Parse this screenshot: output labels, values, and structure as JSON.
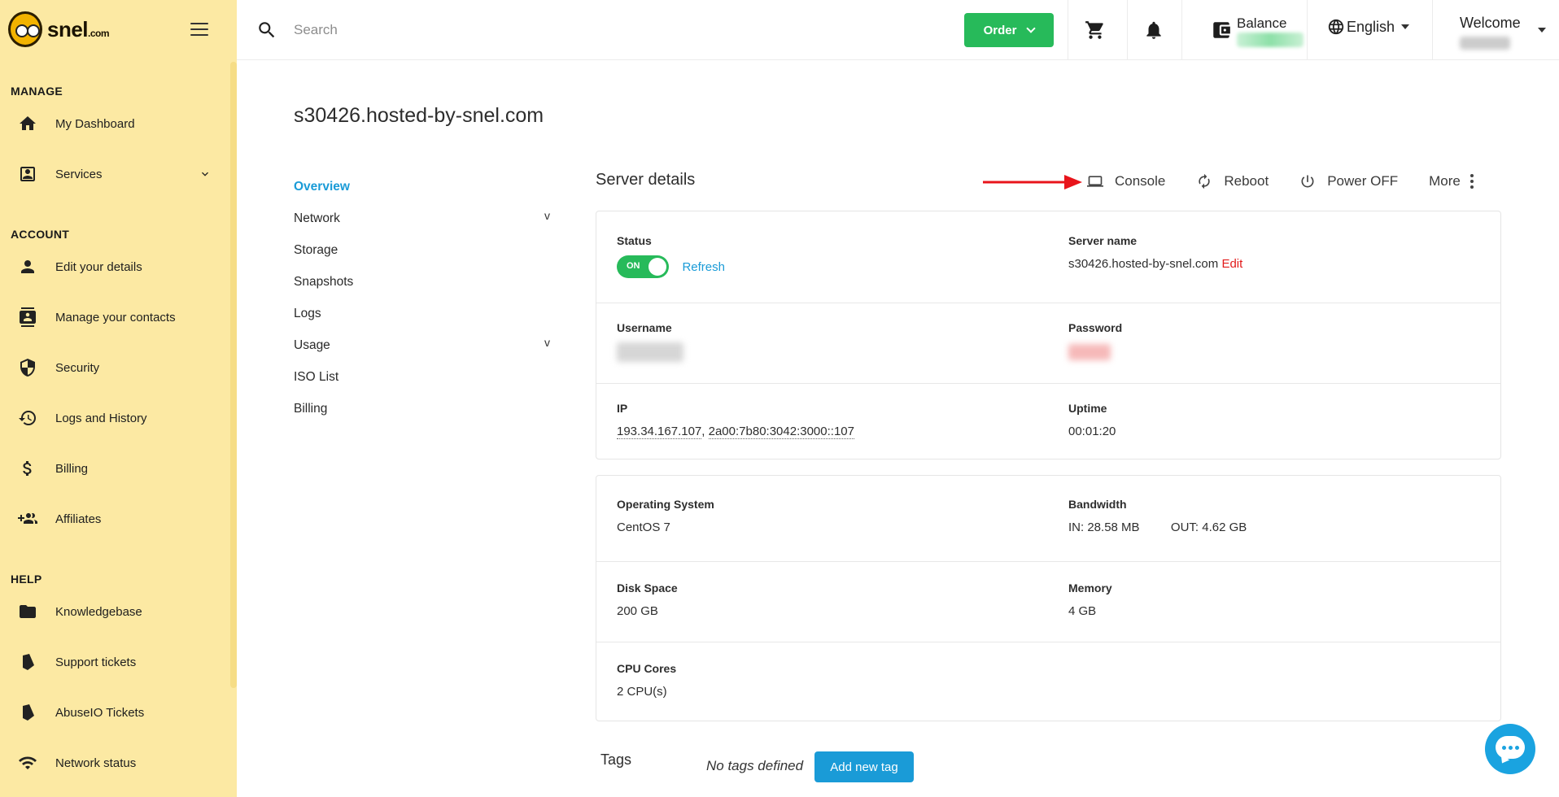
{
  "brand": {
    "name": "snel",
    "tld": ".com"
  },
  "sidebar": {
    "sections": [
      {
        "title": "MANAGE",
        "items": [
          {
            "label": "My Dashboard",
            "icon": "home-icon"
          },
          {
            "label": "Services",
            "icon": "services-icon",
            "expandable": true
          }
        ]
      },
      {
        "title": "ACCOUNT",
        "items": [
          {
            "label": "Edit your details",
            "icon": "person-icon"
          },
          {
            "label": "Manage your contacts",
            "icon": "contacts-icon"
          },
          {
            "label": "Security",
            "icon": "shield-icon"
          },
          {
            "label": "Logs and History",
            "icon": "history-icon"
          },
          {
            "label": "Billing",
            "icon": "dollar-icon"
          },
          {
            "label": "Affiliates",
            "icon": "group-add-icon"
          }
        ]
      },
      {
        "title": "HELP",
        "items": [
          {
            "label": "Knowledgebase",
            "icon": "folder-icon"
          },
          {
            "label": "Support tickets",
            "icon": "ticket-icon"
          },
          {
            "label": "AbuseIO Tickets",
            "icon": "ticket-icon"
          },
          {
            "label": "Network status",
            "icon": "wifi-icon"
          }
        ]
      }
    ]
  },
  "topbar": {
    "search_placeholder": "Search",
    "order_label": "Order",
    "balance_label": "Balance",
    "language": "English",
    "welcome_label": "Welcome"
  },
  "page": {
    "title": "s30426.hosted-by-snel.com",
    "subnav": [
      {
        "label": "Overview",
        "active": true,
        "expandable": false
      },
      {
        "label": "Network",
        "active": false,
        "expandable": true
      },
      {
        "label": "Storage",
        "active": false,
        "expandable": false
      },
      {
        "label": "Snapshots",
        "active": false,
        "expandable": false
      },
      {
        "label": "Logs",
        "active": false,
        "expandable": false
      },
      {
        "label": "Usage",
        "active": false,
        "expandable": true
      },
      {
        "label": "ISO List",
        "active": false,
        "expandable": false
      },
      {
        "label": "Billing",
        "active": false,
        "expandable": false
      }
    ],
    "subnav_expand_glyph": "v",
    "section_title": "Server details",
    "actions": {
      "console": "Console",
      "reboot": "Reboot",
      "power_off": "Power OFF",
      "more": "More"
    },
    "details": {
      "status_label": "Status",
      "status_toggle": "ON",
      "refresh": "Refresh",
      "server_name_label": "Server name",
      "server_name": "s30426.hosted-by-snel.com",
      "edit": "Edit",
      "username_label": "Username",
      "password_label": "Password",
      "ip_label": "IP",
      "ipv4": "193.34.167.107",
      "ip_sep": ", ",
      "ipv6": "2a00:7b80:3042:3000::107",
      "uptime_label": "Uptime",
      "uptime": "00:01:20"
    },
    "specs": {
      "os_label": "Operating System",
      "os": "CentOS 7",
      "bandwidth_label": "Bandwidth",
      "bw_in_label": "IN:",
      "bw_in": "28.58 MB",
      "bw_out_label": "OUT:",
      "bw_out": "4.62 GB",
      "disk_label": "Disk Space",
      "disk": "200 GB",
      "memory_label": "Memory",
      "memory": "4 GB",
      "cpu_label": "CPU Cores",
      "cpu": "2 CPU(s)"
    },
    "tags": {
      "label": "Tags",
      "empty": "No tags defined",
      "add": "Add new tag"
    }
  },
  "colors": {
    "sidebar_bg": "#fce9a3",
    "accent_green": "#27ba5a",
    "accent_blue": "#1a9bd7",
    "edit_red": "#e21b1b",
    "arrow_red": "#e8141b"
  }
}
